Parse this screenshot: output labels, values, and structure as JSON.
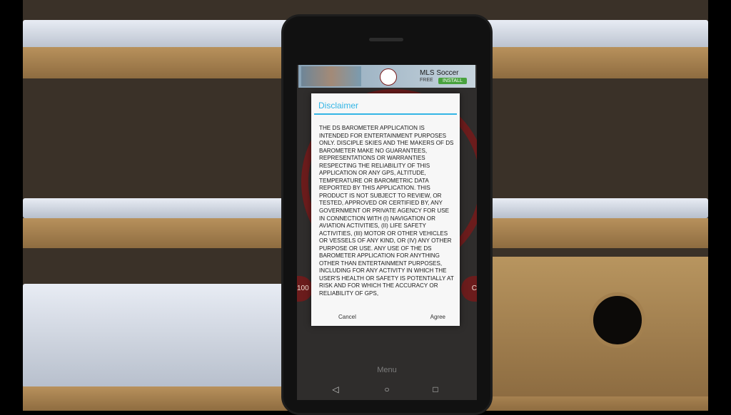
{
  "ad": {
    "title": "MLS Soccer",
    "subtitle": "FREE",
    "install_label": "INSTALL"
  },
  "gauge": {
    "left_value": "100",
    "right_value": "C"
  },
  "dialog": {
    "title": "Disclaimer",
    "body": "THE DS BAROMETER APPLICATION IS INTENDED FOR ENTERTAINMENT PURPOSES ONLY. DISCIPLE SKIES AND THE MAKERS OF DS BAROMETER MAKE NO GUARANTEES, REPRESENTATIONS OR WARRANTIES RESPECTING THE RELIABILITY OF THIS APPLICATION OR ANY GPS, ALTITUDE, TEMPERATURE OR BAROMETRIC DATA REPORTED BY THIS APPLICATION. THIS PRODUCT IS NOT SUBJECT TO REVIEW, OR TESTED, APPROVED OR CERTIFIED BY, ANY GOVERNMENT OR PRIVATE AGENCY FOR USE IN CONNECTION WITH (I) NAVIGATION OR AVIATION ACTIVITIES, (II) LIFE SAFETY ACTIVITIES, (III) MOTOR OR OTHER VEHICLES OR VESSELS OF ANY KIND, OR (IV) ANY OTHER PURPOSE OR USE. ANY USE OF THE DS BAROMETER APPLICATION FOR ANYTHING OTHER THAN ENTERTAINMENT PURPOSES, INCLUDING FOR ANY ACTIVITY IN WHICH THE USER'S HEALTH OR SAFETY IS POTENTIALLY AT RISK AND FOR WHICH THE ACCURACY OR RELIABILITY OF GPS,",
    "cancel_label": "Cancel",
    "agree_label": "Agree"
  },
  "menu_label": "Menu",
  "nav": {
    "back_icon": "◁",
    "home_icon": "○",
    "recent_icon": "□"
  },
  "colors": {
    "accent": "#33b5e5",
    "gauge": "#6b1c1c"
  }
}
